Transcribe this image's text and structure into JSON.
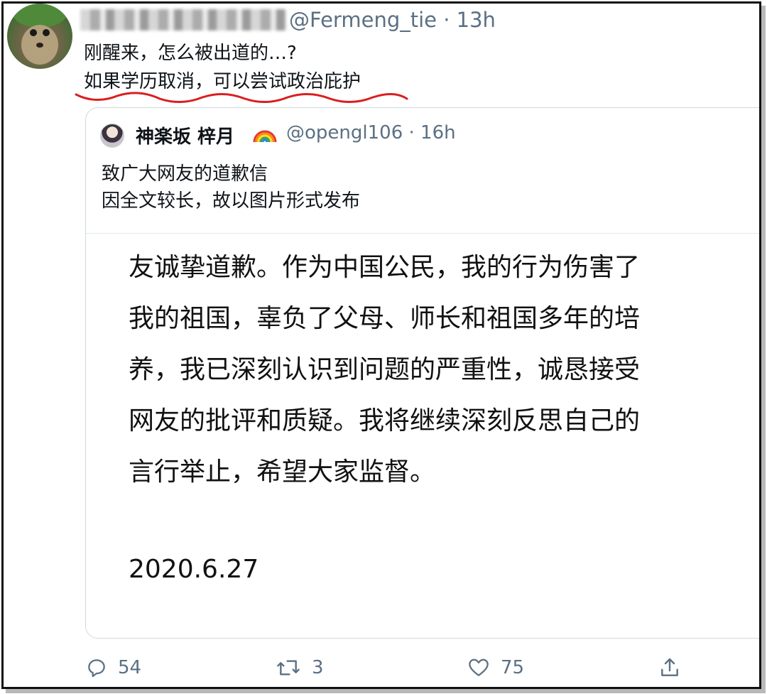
{
  "tweet": {
    "handle": "@Fermeng_tie",
    "separator": "·",
    "time": "13h",
    "lines": [
      "刚醒来，怎么被出道的…?",
      "如果学历取消，可以尝试政治庇护"
    ]
  },
  "quoted": {
    "display_name": "神楽坂 梓月",
    "handle": "@opengl106",
    "separator": "·",
    "time": "16h",
    "lines": [
      "致广大网友的道歉信",
      "因全文较长，故以图片形式发布"
    ],
    "image": {
      "lines": [
        "友诚挚道歉。作为中国公民，我的行为伤害了",
        "我的祖国，辜负了父母、师长和祖国多年的培",
        "养，我已深刻认识到问题的严重性，诚恳接受",
        "网友的批评和质疑。我将继续深刻反思自己的",
        "言行举止，希望大家监督。"
      ],
      "date": "2020.6.27"
    }
  },
  "actions": {
    "replies": "54",
    "retweets": "3",
    "likes": "75"
  },
  "colors": {
    "secondary_text": "#5b7083",
    "annotation_red": "#d91f1f",
    "border": "#cfd9de"
  }
}
